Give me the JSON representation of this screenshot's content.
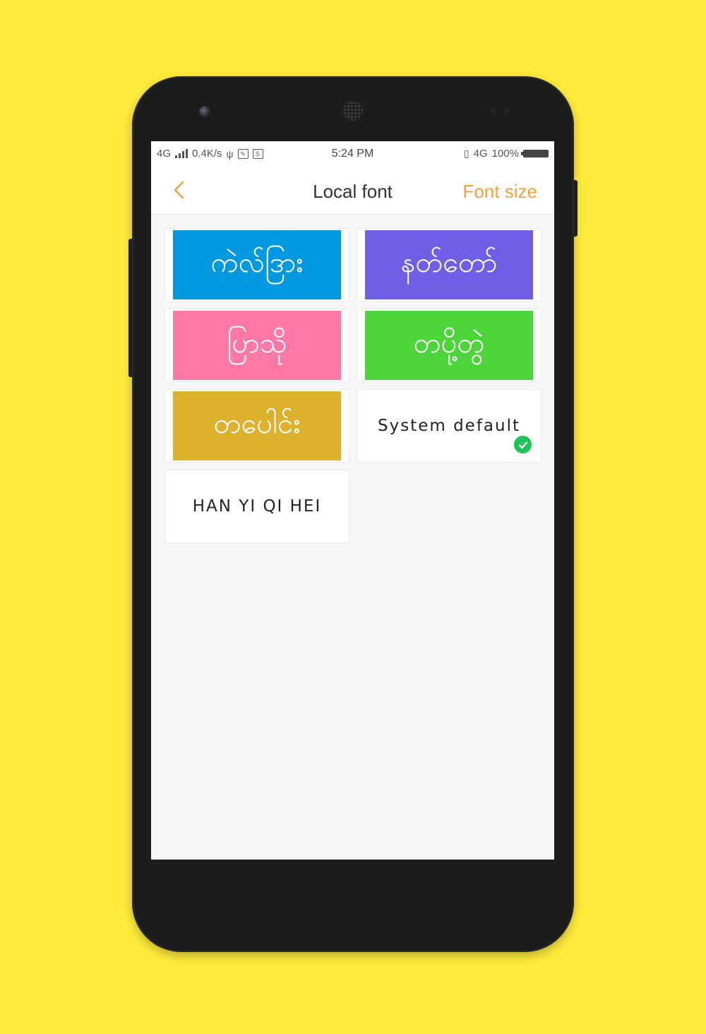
{
  "status_bar": {
    "network": "4G",
    "speed": "0.4K/s",
    "time": "5:24 PM",
    "network_right": "4G",
    "battery": "100%"
  },
  "nav": {
    "title": "Local font",
    "action": "Font size"
  },
  "fonts": [
    {
      "label": "ကဲလ်ဒြား",
      "color": "#0099e0"
    },
    {
      "label": "နတ်တော်",
      "color": "#6f5fe6"
    },
    {
      "label": "ပြာသို",
      "color": "#ff78a6"
    },
    {
      "label": "တပို့တွဲ",
      "color": "#4cd43a"
    },
    {
      "label": "တပေါင်း",
      "color": "#ddb02e"
    },
    {
      "label": "System default",
      "selected": true
    },
    {
      "label": "HAN YI QI HEI"
    }
  ],
  "icons": {
    "back": "chevron-left-icon",
    "selected": "check-circle-icon"
  }
}
